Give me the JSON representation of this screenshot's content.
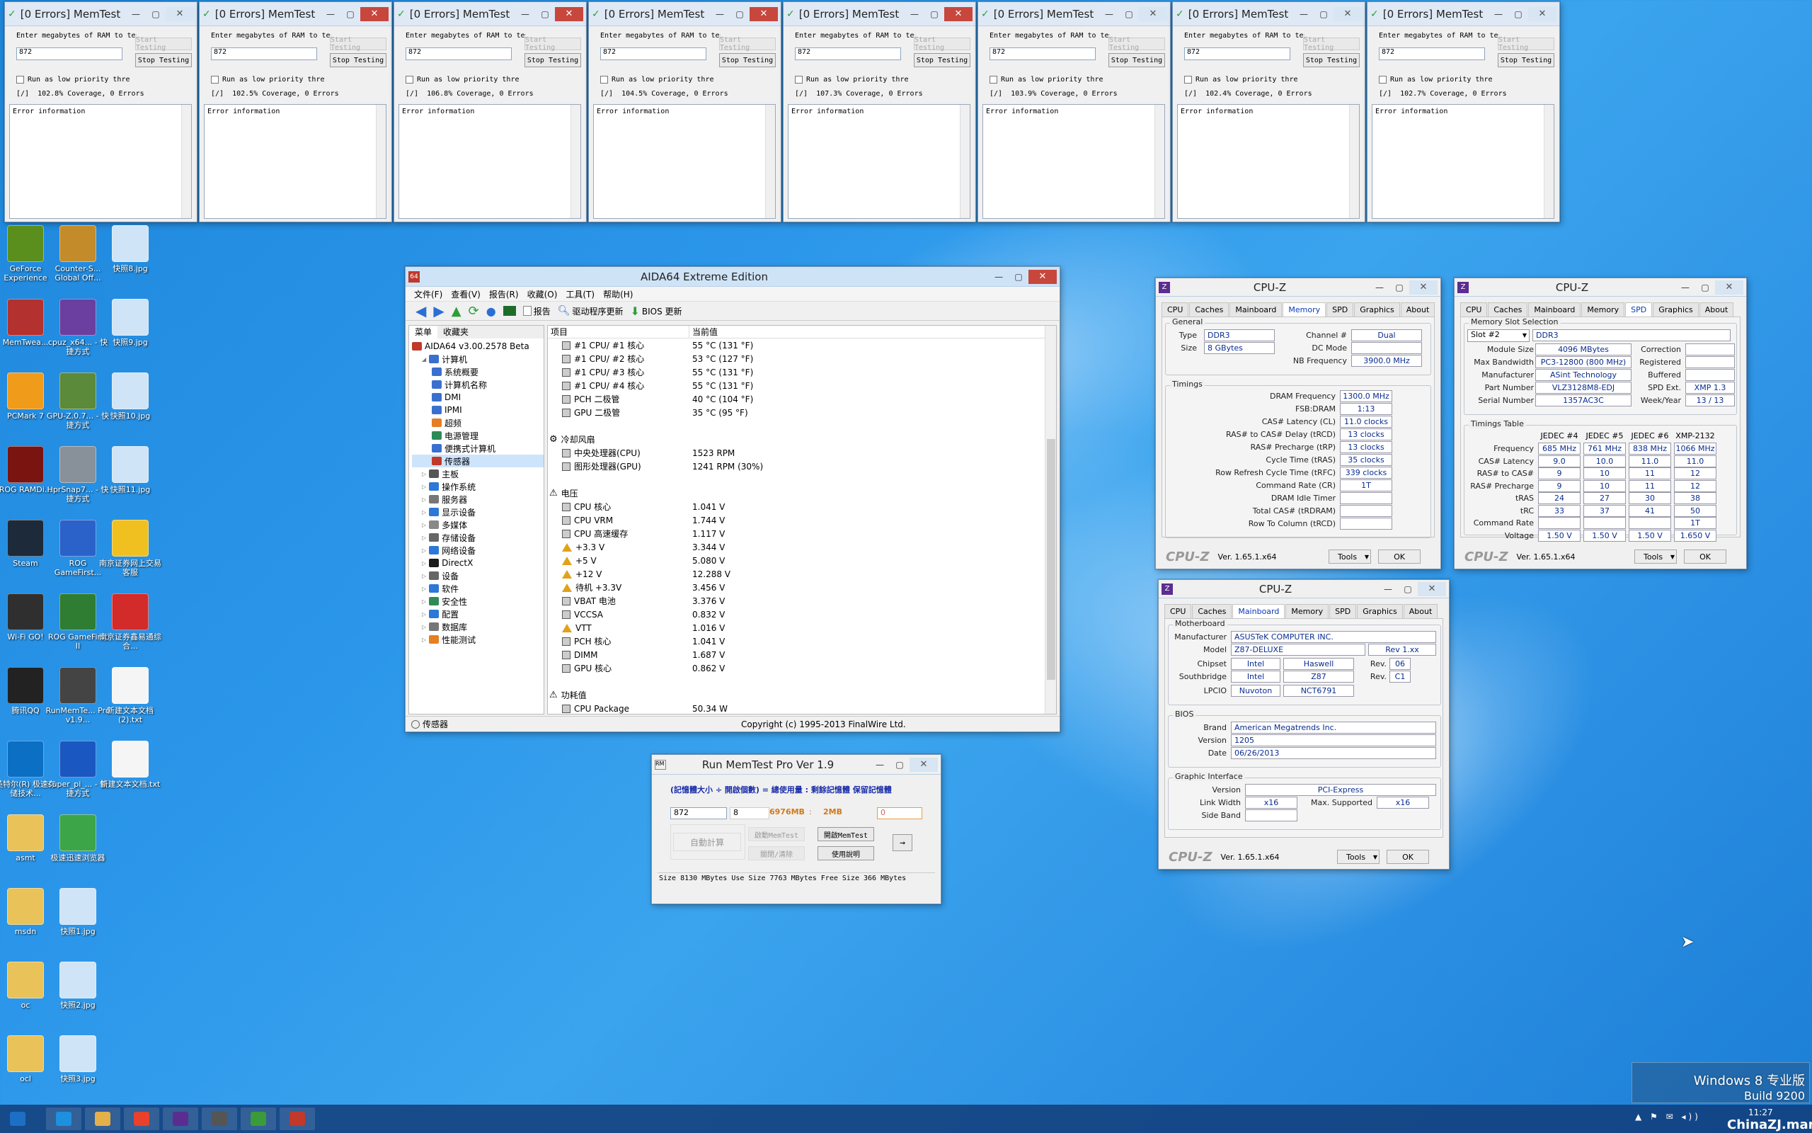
{
  "memtest_windows": [
    {
      "title": "[0 Errors] MemTest",
      "prompt": "Enter megabytes of RAM to test",
      "value": "872",
      "start": "Start Testing",
      "stop": "Stop Testing",
      "low_priority": "Run as low priority thre",
      "status": "[/]  102.8% Coverage, 0 Errors",
      "error_label": "Error information"
    },
    {
      "title": "[0 Errors] MemTest",
      "prompt": "Enter megabytes of RAM to test",
      "value": "872",
      "start": "Start Testing",
      "stop": "Stop Testing",
      "low_priority": "Run as low priority thre",
      "status": "[/]  102.5% Coverage, 0 Errors",
      "error_label": "Error information"
    },
    {
      "title": "[0 Errors] MemTest",
      "prompt": "Enter megabytes of RAM to test",
      "value": "872",
      "start": "Start Testing",
      "stop": "Stop Testing",
      "low_priority": "Run as low priority thre",
      "status": "[/]  106.8% Coverage, 0 Errors",
      "error_label": "Error information"
    },
    {
      "title": "[0 Errors] MemTest",
      "prompt": "Enter megabytes of RAM to test",
      "value": "872",
      "start": "Start Testing",
      "stop": "Stop Testing",
      "low_priority": "Run as low priority thre",
      "status": "[/]  104.5% Coverage, 0 Errors",
      "error_label": "Error information"
    },
    {
      "title": "[0 Errors] MemTest",
      "prompt": "Enter megabytes of RAM to test",
      "value": "872",
      "start": "Start Testing",
      "stop": "Stop Testing",
      "low_priority": "Run as low priority thre",
      "status": "[/]  107.3% Coverage, 0 Errors",
      "error_label": "Error information"
    },
    {
      "title": "[0 Errors] MemTest",
      "prompt": "Enter megabytes of RAM to test",
      "value": "872",
      "start": "Start Testing",
      "stop": "Stop Testing",
      "low_priority": "Run as low priority thre",
      "status": "[/]  103.9% Coverage, 0 Errors",
      "error_label": "Error information"
    },
    {
      "title": "[0 Errors] MemTest",
      "prompt": "Enter megabytes of RAM to test",
      "value": "872",
      "start": "Start Testing",
      "stop": "Stop Testing",
      "low_priority": "Run as low priority thre",
      "status": "[/]  102.4% Coverage, 0 Errors",
      "error_label": "Error information"
    },
    {
      "title": "[0 Errors] MemTest",
      "prompt": "Enter megabytes of RAM to test",
      "value": "872",
      "start": "Start Testing",
      "stop": "Stop Testing",
      "low_priority": "Run as low priority thre",
      "status": "[/]  102.7% Coverage, 0 Errors",
      "error_label": "Error information"
    }
  ],
  "desktop_icons": [
    {
      "label": "GeForce Experience",
      "icon": "geforce-icon",
      "color": "#5a8f1e"
    },
    {
      "label": "Counter-S... Global Off...",
      "icon": "csgo-icon",
      "color": "#c48b2a"
    },
    {
      "label": "快照8.jpg",
      "icon": "image-file-icon",
      "color": "#cfe4f7"
    },
    {
      "label": "MemTwea...",
      "icon": "memtweak-icon",
      "color": "#b3312e"
    },
    {
      "label": "cpuz_x64... - 快捷方式",
      "icon": "cpuz-icon",
      "color": "#6a3fa0"
    },
    {
      "label": "快照9.jpg",
      "icon": "image-file-icon",
      "color": "#cfe4f7"
    },
    {
      "label": "PCMark 7",
      "icon": "pcmark-icon",
      "color": "#f19b1b"
    },
    {
      "label": "GPU-Z.0.7... - 快捷方式",
      "icon": "gpuz-icon",
      "color": "#5b8a3a"
    },
    {
      "label": "快照10.jpg",
      "icon": "image-file-icon",
      "color": "#cfe4f7"
    },
    {
      "label": "ROG RAMDi...",
      "icon": "rog-ramdisk-icon",
      "color": "#7a1410"
    },
    {
      "label": "HprSnap7... - 快捷方式",
      "icon": "hypersnap-icon",
      "color": "#889099"
    },
    {
      "label": "快照11.jpg",
      "icon": "image-file-icon",
      "color": "#cfe4f7"
    },
    {
      "label": "Steam",
      "icon": "steam-icon",
      "color": "#1d2a3a"
    },
    {
      "label": "ROG GameFirst...",
      "icon": "rog-gamefirst-icon",
      "color": "#2a62c9"
    },
    {
      "label": "南京证券网上交易客服",
      "icon": "stock-app-icon",
      "color": "#f0c020"
    },
    {
      "label": "Wi-Fi GO!",
      "icon": "wifi-go-icon",
      "color": "#2f2f2f"
    },
    {
      "label": "ROG GameFirst II",
      "icon": "rog-gamefirst2-icon",
      "color": "#2e7d32"
    },
    {
      "label": "南京证券鑫易通综合...",
      "icon": "stock-app2-icon",
      "color": "#d32a2a"
    },
    {
      "label": "腾讯QQ",
      "icon": "qq-icon",
      "color": "#222222"
    },
    {
      "label": "RunMemTe... Pro v1.9...",
      "icon": "runmemtest-icon",
      "color": "#444444"
    },
    {
      "label": "新建文本文档 (2).txt",
      "icon": "text-file-icon",
      "color": "#f5f5f5"
    },
    {
      "label": "英特尔(R) 极速存储技术...",
      "icon": "intel-rst-icon",
      "color": "#0b6fc4"
    },
    {
      "label": "super_pi_... - 快捷方式",
      "icon": "superpi-icon",
      "color": "#1b57c0"
    },
    {
      "label": "新建文本文档.txt",
      "icon": "text-file-icon",
      "color": "#f5f5f5"
    },
    {
      "label": "asmt",
      "icon": "folder-icon",
      "color": "#e9c25a"
    },
    {
      "label": "极速迅速浏览器",
      "icon": "browser-icon",
      "color": "#3ca548"
    },
    {
      "label": "msdn",
      "icon": "folder-icon",
      "color": "#e9c25a"
    },
    {
      "label": "快照1.jpg",
      "icon": "image-file-icon",
      "color": "#cfe4f7"
    },
    {
      "label": "oc",
      "icon": "folder-icon",
      "color": "#e9c25a"
    },
    {
      "label": "快照2.jpg",
      "icon": "image-file-icon",
      "color": "#cfe4f7"
    },
    {
      "label": "ocl",
      "icon": "folder-icon",
      "color": "#e9c25a"
    },
    {
      "label": "快照3.jpg",
      "icon": "image-file-icon",
      "color": "#cfe4f7"
    }
  ],
  "aida": {
    "title": "AIDA64 Extreme Edition",
    "menu": [
      "文件(F)",
      "查看(V)",
      "报告(R)",
      "收藏(O)",
      "工具(T)",
      "帮助(H)"
    ],
    "toolbar": {
      "report": "报告",
      "driver_update": "驱动程序更新",
      "bios_update": "BIOS 更新"
    },
    "panel_tabs": [
      "菜单",
      "收藏夹"
    ],
    "tree": [
      {
        "label": "AIDA64 v3.00.2578 Beta",
        "level": 0,
        "color": "#c0392b"
      },
      {
        "label": "计算机",
        "level": 1,
        "color": "#3a6fd0"
      },
      {
        "label": "系统概要",
        "level": 2,
        "color": "#3a6fd0"
      },
      {
        "label": "计算机名称",
        "level": 2,
        "color": "#3a6fd0"
      },
      {
        "label": "DMI",
        "level": 2,
        "color": "#3a6fd0"
      },
      {
        "label": "IPMI",
        "level": 2,
        "color": "#3a6fd0"
      },
      {
        "label": "超频",
        "level": 2,
        "color": "#e67e22"
      },
      {
        "label": "电源管理",
        "level": 2,
        "color": "#2e8b57"
      },
      {
        "label": "便携式计算机",
        "level": 2,
        "color": "#3a6fd0"
      },
      {
        "label": "传感器",
        "level": 2,
        "color": "#c0392b"
      },
      {
        "label": "主板",
        "level": 1,
        "color": "#555555"
      },
      {
        "label": "操作系统",
        "level": 1,
        "color": "#2b78d8"
      },
      {
        "label": "服务器",
        "level": 1,
        "color": "#777777"
      },
      {
        "label": "显示设备",
        "level": 1,
        "color": "#2b78d8"
      },
      {
        "label": "多媒体",
        "level": 1,
        "color": "#888888"
      },
      {
        "label": "存储设备",
        "level": 1,
        "color": "#666666"
      },
      {
        "label": "网络设备",
        "level": 1,
        "color": "#2b78d8"
      },
      {
        "label": "DirectX",
        "level": 1,
        "color": "#1a1a1a"
      },
      {
        "label": "设备",
        "level": 1,
        "color": "#666666"
      },
      {
        "label": "软件",
        "level": 1,
        "color": "#2b78d8"
      },
      {
        "label": "安全性",
        "level": 1,
        "color": "#2e8b57"
      },
      {
        "label": "配置",
        "level": 1,
        "color": "#2b78d8"
      },
      {
        "label": "数据库",
        "level": 1,
        "color": "#777777"
      },
      {
        "label": "性能测试",
        "level": 1,
        "color": "#e67e22"
      }
    ],
    "col_item": "项目",
    "col_value": "当前值",
    "rows": [
      {
        "type": "item",
        "k": "#1 CPU/ #1 核心",
        "v": "55 °C  (131 °F)"
      },
      {
        "type": "item",
        "k": "#1 CPU/ #2 核心",
        "v": "53 °C  (127 °F)"
      },
      {
        "type": "item",
        "k": "#1 CPU/ #3 核心",
        "v": "55 °C  (131 °F)"
      },
      {
        "type": "item",
        "k": "#1 CPU/ #4 核心",
        "v": "55 °C  (131 °F)"
      },
      {
        "type": "item",
        "k": "PCH 二极管",
        "v": "40 °C  (104 °F)"
      },
      {
        "type": "item",
        "k": "GPU 二极管",
        "v": "35 °C  (95 °F)"
      },
      {
        "type": "blank",
        "k": "",
        "v": ""
      },
      {
        "type": "section",
        "k": "冷却风扇",
        "v": ""
      },
      {
        "type": "item",
        "k": "中央处理器(CPU)",
        "v": "1523 RPM"
      },
      {
        "type": "item",
        "k": "图形处理器(GPU)",
        "v": "1241 RPM  (30%)"
      },
      {
        "type": "blank",
        "k": "",
        "v": ""
      },
      {
        "type": "section",
        "k": "电压",
        "v": ""
      },
      {
        "type": "item",
        "k": "CPU 核心",
        "v": "1.041 V"
      },
      {
        "type": "item",
        "k": "CPU VRM",
        "v": "1.744 V"
      },
      {
        "type": "item",
        "k": "CPU 高速缓存",
        "v": "1.117 V"
      },
      {
        "type": "warn",
        "k": "+3.3 V",
        "v": "3.344 V"
      },
      {
        "type": "warn",
        "k": "+5 V",
        "v": "5.080 V"
      },
      {
        "type": "warn",
        "k": "+12 V",
        "v": "12.288 V"
      },
      {
        "type": "warn",
        "k": "待机 +3.3V",
        "v": "3.456 V"
      },
      {
        "type": "item",
        "k": "VBAT 电池",
        "v": "3.376 V"
      },
      {
        "type": "item",
        "k": "VCCSA",
        "v": "0.832 V"
      },
      {
        "type": "warn",
        "k": "VTT",
        "v": "1.016 V"
      },
      {
        "type": "item",
        "k": "PCH 核心",
        "v": "1.041 V"
      },
      {
        "type": "item",
        "k": "DIMM",
        "v": "1.687 V"
      },
      {
        "type": "item",
        "k": "GPU 核心",
        "v": "0.862 V"
      },
      {
        "type": "blank",
        "k": "",
        "v": ""
      },
      {
        "type": "section",
        "k": "功耗值",
        "v": ""
      },
      {
        "type": "item",
        "k": "CPU Package",
        "v": "50.34 W"
      }
    ],
    "status_left": "传感器",
    "status_right": "Copyright (c) 1995-2013 FinalWire Ltd."
  },
  "runmemtest": {
    "title": "Run MemTest Pro Ver 1.9",
    "formula": "(記憶體大小 ÷ 開啟個數) = 總使用量 : 剩餘記憶體  保留記憶體",
    "size_val": "872",
    "count_val": "8",
    "total": "6976MB",
    ":": ":",
    "remain": "2MB",
    "reserve": "0",
    "btn_calc": "自動計算",
    "btn_run": "啟動MemTest",
    "btn_open": "開啟MemTest",
    "btn_close": "關閉/清除",
    "btn_help": "使用說明",
    "btn_arrow": "→",
    "status": "Size  8130 MBytes  Use Size  7763 MBytes  Free Size  366 MBytes"
  },
  "cpuz_memory": {
    "title": "CPU-Z",
    "tabs": [
      "CPU",
      "Caches",
      "Mainboard",
      "Memory",
      "SPD",
      "Graphics",
      "About"
    ],
    "active": "Memory",
    "general": "General",
    "type_l": "Type",
    "type": "DDR3",
    "channel_l": "Channel #",
    "channel": "Dual",
    "size_l": "Size",
    "size": "8 GBytes",
    "dcmode_l": "DC Mode",
    "nbfreq_l": "NB Frequency",
    "nbfreq": "3900.0 MHz",
    "timings": "Timings",
    "rows": [
      {
        "l": "DRAM Frequency",
        "v": "1300.0 MHz"
      },
      {
        "l": "FSB:DRAM",
        "v": "1:13"
      },
      {
        "l": "CAS# Latency (CL)",
        "v": "11.0 clocks"
      },
      {
        "l": "RAS# to CAS# Delay (tRCD)",
        "v": "13 clocks"
      },
      {
        "l": "RAS# Precharge (tRP)",
        "v": "13 clocks"
      },
      {
        "l": "Cycle Time (tRAS)",
        "v": "35 clocks"
      },
      {
        "l": "Row Refresh Cycle Time (tRFC)",
        "v": "339 clocks"
      },
      {
        "l": "Command Rate (CR)",
        "v": "1T"
      },
      {
        "l": "DRAM Idle Timer",
        "v": ""
      },
      {
        "l": "Total CAS# (tRDRAM)",
        "v": ""
      },
      {
        "l": "Row To Column (tRCD)",
        "v": ""
      }
    ],
    "brand": "CPU-Z",
    "ver": "Ver. 1.65.1.x64",
    "tools": "Tools",
    "ok": "OK"
  },
  "cpuz_spd": {
    "title": "CPU-Z",
    "tabs": [
      "CPU",
      "Caches",
      "Mainboard",
      "Memory",
      "SPD",
      "Graphics",
      "About"
    ],
    "active": "SPD",
    "slot_sel": "Memory Slot Selection",
    "slot": "Slot #2",
    "slot_type": "DDR3",
    "module_l": "Module Size",
    "module": "4096 MBytes",
    "correction_l": "Correction",
    "bw_l": "Max Bandwidth",
    "bw": "PC3-12800 (800 MHz)",
    "registered_l": "Registered",
    "mfr_l": "Manufacturer",
    "mfr": "ASint Technology",
    "buffered_l": "Buffered",
    "part_l": "Part Number",
    "part": "VLZ3128M8-EDJ",
    "spdext_l": "SPD Ext.",
    "spdext": "XMP 1.3",
    "serial_l": "Serial Number",
    "serial": "1357AC3C",
    "week_l": "Week/Year",
    "week": "13 / 13",
    "table_title": "Timings Table",
    "cols": [
      "JEDEC #4",
      "JEDEC #5",
      "JEDEC #6",
      "XMP-2132"
    ],
    "trows": [
      {
        "l": "Frequency",
        "v": [
          "685 MHz",
          "761 MHz",
          "838 MHz",
          "1066 MHz"
        ]
      },
      {
        "l": "CAS# Latency",
        "v": [
          "9.0",
          "10.0",
          "11.0",
          "11.0"
        ]
      },
      {
        "l": "RAS# to CAS#",
        "v": [
          "9",
          "10",
          "11",
          "12"
        ]
      },
      {
        "l": "RAS# Precharge",
        "v": [
          "9",
          "10",
          "11",
          "12"
        ]
      },
      {
        "l": "tRAS",
        "v": [
          "24",
          "27",
          "30",
          "38"
        ]
      },
      {
        "l": "tRC",
        "v": [
          "33",
          "37",
          "41",
          "50"
        ]
      },
      {
        "l": "Command Rate",
        "v": [
          "",
          "",
          "",
          "1T"
        ]
      },
      {
        "l": "Voltage",
        "v": [
          "1.50 V",
          "1.50 V",
          "1.50 V",
          "1.650 V"
        ]
      }
    ],
    "brand": "CPU-Z",
    "ver": "Ver. 1.65.1.x64",
    "tools": "Tools",
    "ok": "OK"
  },
  "cpuz_mb": {
    "title": "CPU-Z",
    "tabs": [
      "CPU",
      "Caches",
      "Mainboard",
      "Memory",
      "SPD",
      "Graphics",
      "About"
    ],
    "active": "Mainboard",
    "motherboard": "Motherboard",
    "mfr_l": "Manufacturer",
    "mfr": "ASUSTeK COMPUTER INC.",
    "model_l": "Model",
    "model": "Z87-DELUXE",
    "rev_model": "Rev 1.xx",
    "chipset_l": "Chipset",
    "chipset_a": "Intel",
    "chipset_b": "Haswell",
    "rev_l": "Rev.",
    "chipset_rev": "06",
    "south_l": "Southbridge",
    "south_a": "Intel",
    "south_b": "Z87",
    "south_rev": "C1",
    "lpcio_l": "LPCIO",
    "lpcio_a": "Nuvoton",
    "lpcio_b": "NCT6791",
    "bios": "BIOS",
    "brand_l": "Brand",
    "brand_v": "American Megatrends Inc.",
    "version_l": "Version",
    "version_v": "1205",
    "date_l": "Date",
    "date_v": "06/26/2013",
    "gi": "Graphic Interface",
    "giver_l": "Version",
    "giver": "PCI-Express",
    "lw_l": "Link Width",
    "lw": "x16",
    "maxs_l": "Max. Supported",
    "maxs": "x16",
    "sideband_l": "Side Band",
    "brand": "CPU-Z",
    "ver": "Ver. 1.65.1.x64",
    "tools": "Tools",
    "ok": "OK"
  },
  "os": {
    "watermark_1": "Windows 8 专业版",
    "watermark_2": "Build 9200",
    "clock": "11:27",
    "corner_text": "ChinaZJ.man"
  },
  "taskbar_items": [
    "start-icon",
    "ie-icon",
    "explorer-icon",
    "chrome-icon",
    "cpuz-task-icon",
    "runmemtest-task-icon",
    "memtest-task-icon",
    "aida64-task-icon"
  ]
}
